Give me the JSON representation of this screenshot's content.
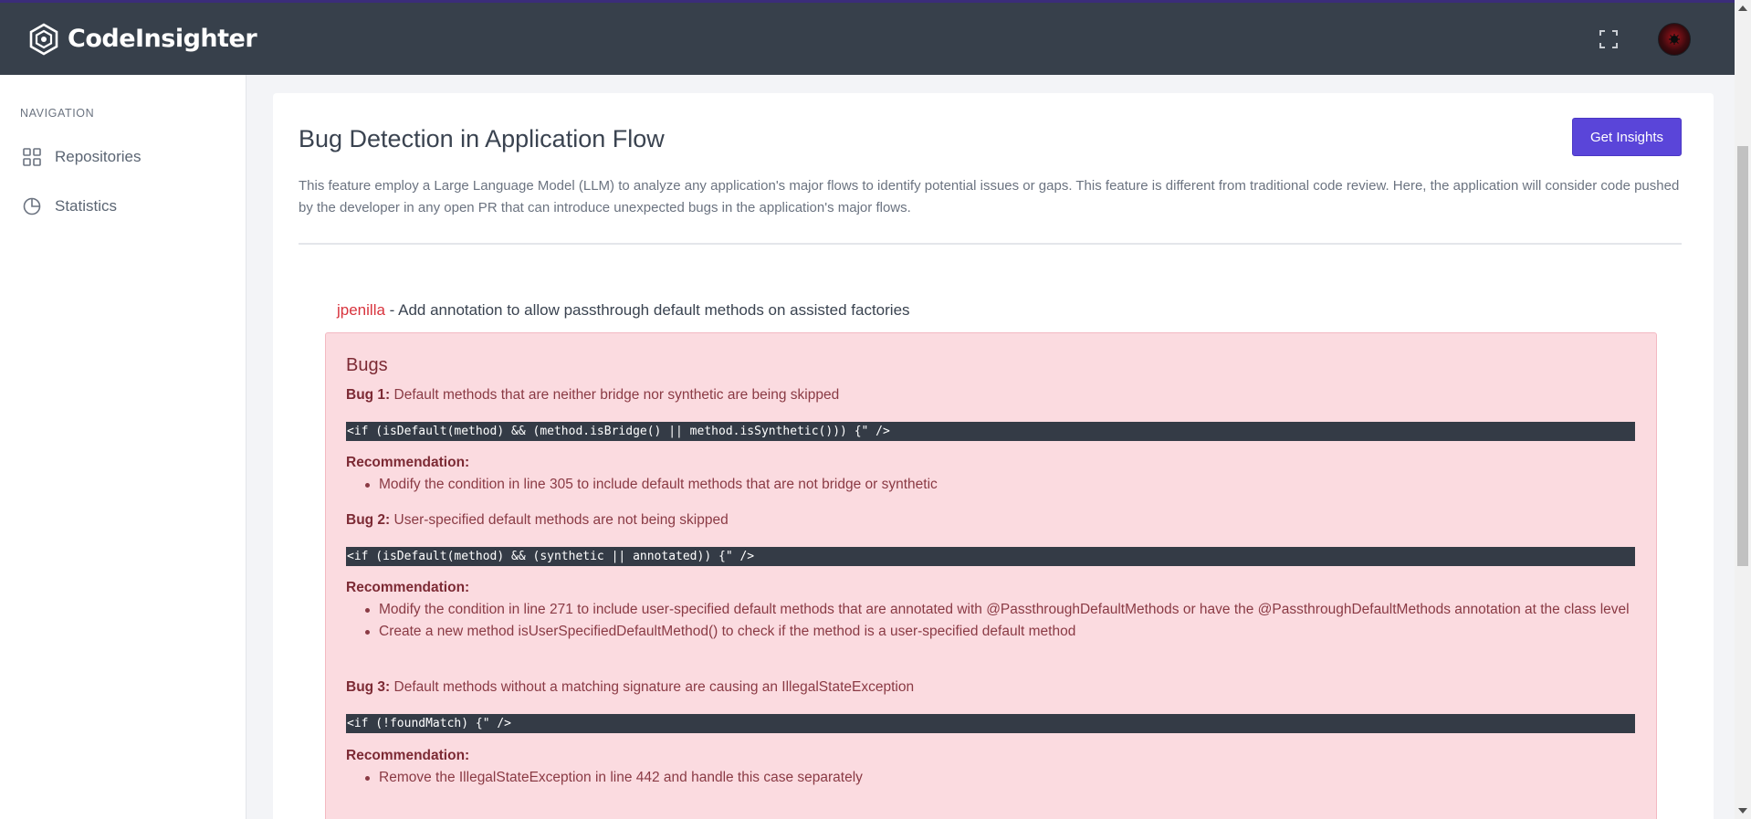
{
  "brand": {
    "name": "CodeInsighter"
  },
  "sidebar": {
    "title": "NAVIGATION",
    "items": [
      {
        "label": "Repositories",
        "icon": "grid-icon"
      },
      {
        "label": "Statistics",
        "icon": "pie-chart-icon"
      }
    ]
  },
  "main": {
    "title": "Bug Detection in Application Flow",
    "insights_button": "Get Insights",
    "description": "This feature employ a Large Language Model (LLM) to analyze any application's major flows to identify potential issues or gaps. This feature is different from traditional code review. Here, the application will consider code pushed by the developer in any open PR that can introduce unexpected bugs in the application's major flows.",
    "pr": {
      "author": "jpenilla",
      "separator": " - ",
      "title": "Add annotation to allow passthrough default methods on assisted factories"
    },
    "bugs_heading": "Bugs",
    "bugs": [
      {
        "label": "Bug 1:",
        "description": "Default methods that are neither bridge nor synthetic are being skipped",
        "code": "<if (isDefault(method) && (method.isBridge() || method.isSynthetic())) {\" />",
        "recommendation_label": "Recommendation:",
        "recommendations": [
          "Modify the condition in line 305 to include default methods that are not bridge or synthetic"
        ]
      },
      {
        "label": "Bug 2:",
        "description": "User-specified default methods are not being skipped",
        "code": "<if (isDefault(method) && (synthetic || annotated)) {\" />",
        "recommendation_label": "Recommendation:",
        "recommendations": [
          "Modify the condition in line 271 to include user-specified default methods that are annotated with @PassthroughDefaultMethods or have the @PassthroughDefaultMethods annotation at the class level",
          "Create a new method isUserSpecifiedDefaultMethod() to check if the method is a user-specified default method"
        ]
      },
      {
        "label": "Bug 3:",
        "description": "Default methods without a matching signature are causing an IllegalStateException",
        "code": "<if (!foundMatch) {\" />",
        "recommendation_label": "Recommendation:",
        "recommendations": [
          "Remove the IllegalStateException in line 442 and handle this case separately"
        ]
      }
    ]
  },
  "colors": {
    "topbar": "#37404b",
    "accent": "#5a45d9",
    "author": "#d8333d",
    "bug_panel": "#fbdbe0"
  }
}
